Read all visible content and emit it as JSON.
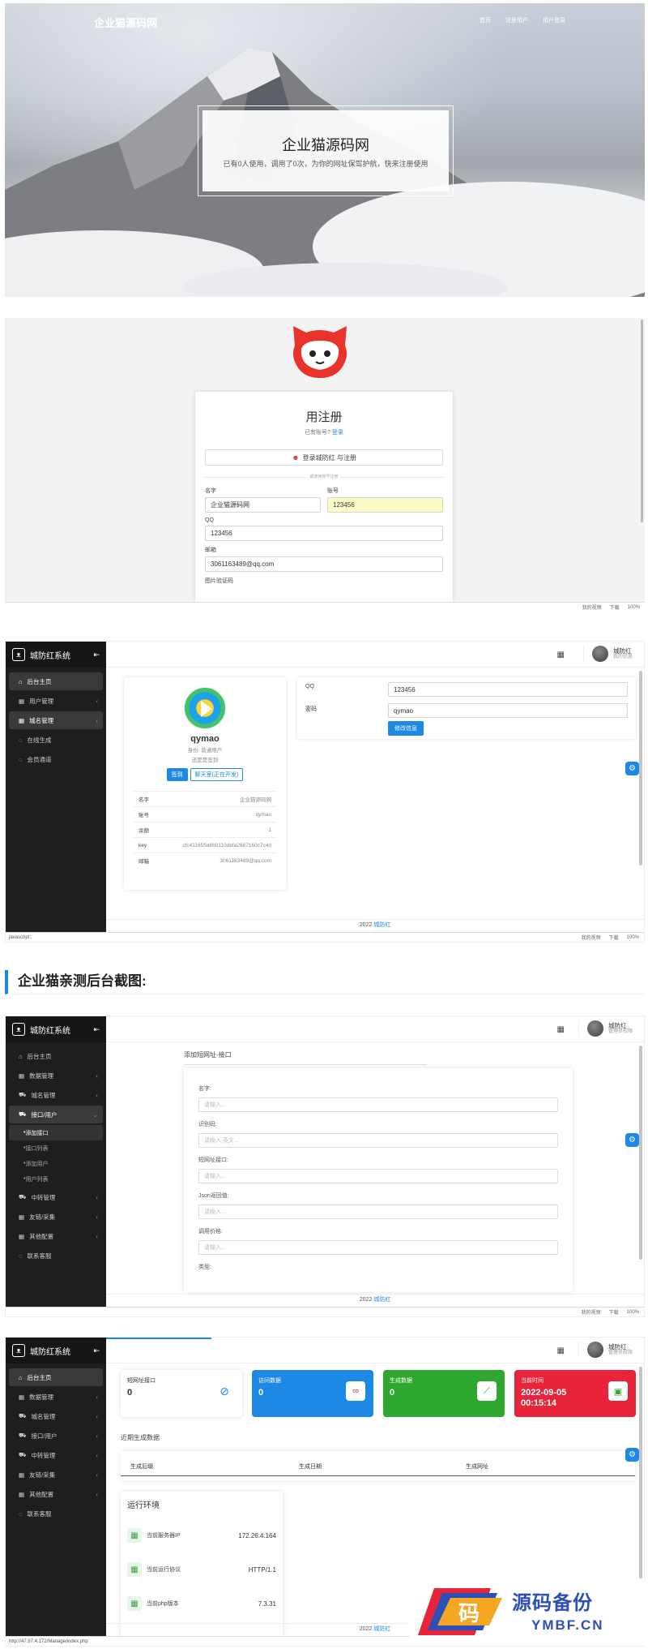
{
  "hero": {
    "site_name": "企业猫源码网",
    "nav": [
      "首页",
      "注册用户",
      "用户登录"
    ],
    "title": "企业猫源码网",
    "subtitle": "已有0人使用，调用了0次，为你的网址保驾护航，快来注册使用"
  },
  "register": {
    "title": "用注册",
    "have_account": "已有账号?",
    "login_link": "登录",
    "qq_button": "登录城防红 与注册",
    "divider": "或使用账号注册",
    "name_label": "名字",
    "name_value": "企业猫源码网",
    "account_label": "账号",
    "account_value": "123456",
    "qq_label": "QQ",
    "qq_value": "123456",
    "email_label": "邮箱",
    "email_value": "3061163489@qq.com",
    "captcha_label": "图片验证码",
    "statusbar": [
      "我的视频",
      "下载",
      "100%"
    ]
  },
  "admin1": {
    "brand": "城防红系统",
    "menu": [
      {
        "label": "后台主页",
        "active": true
      },
      {
        "label": "用户管理",
        "arrow": true
      },
      {
        "label": "城名管理",
        "arrow": true,
        "active": true
      },
      {
        "label": "在线生成"
      },
      {
        "label": "会员通道"
      }
    ],
    "user_name": "城防红",
    "user_role": "我的信息",
    "profile": {
      "name": "qymao",
      "identity": "身份: 普通用户",
      "sign_status": "还是是签到",
      "sign_btn": "签到",
      "chat_btn": "聊天室(正在开发)",
      "rows": [
        {
          "k": "名字",
          "v": "企业猫源码网"
        },
        {
          "k": "账号",
          "v": "qymao"
        },
        {
          "k": "余额",
          "v": "1"
        },
        {
          "k": "key",
          "v": "cfc411655a6b0110defa2687160c7c4d"
        },
        {
          "k": "邮箱",
          "v": "3061163489@qq.com"
        }
      ]
    },
    "qq_label": "QQ",
    "qq_value": "123456",
    "pwd_label": "密码",
    "pwd_value": "qymao",
    "save_btn": "修改信息",
    "footer_year": "2022",
    "footer_link": "城防红",
    "status_left": "javascript:;",
    "statusbar": [
      "我的视频",
      "下载",
      "100%"
    ]
  },
  "heading": "企业猫亲测后台截图:",
  "admin2": {
    "brand": "城防红系统",
    "menu": [
      {
        "label": "后台主页"
      },
      {
        "label": "数据管理",
        "arrow": true
      },
      {
        "label": "城名管理",
        "arrow": true
      },
      {
        "label": "接口/用户",
        "arrow": true,
        "active": true
      }
    ],
    "submenu": [
      {
        "label": "添加接口",
        "active": true
      },
      {
        "label": "接口列表"
      },
      {
        "label": "添加用户"
      },
      {
        "label": "用户列表"
      }
    ],
    "menu2": [
      {
        "label": "中转管理",
        "arrow": true
      },
      {
        "label": "友链/采集",
        "arrow": true
      },
      {
        "label": "其他配置",
        "arrow": true
      },
      {
        "label": "联系客服"
      }
    ],
    "user_name": "城防红",
    "user_role": "管理员权限",
    "form_title": "添加短网址-接口",
    "fields": [
      {
        "label": "名字:",
        "placeholder": "请输入..."
      },
      {
        "label": "识别码:",
        "placeholder": "请输入,英文..."
      },
      {
        "label": "短网址接口:",
        "placeholder": "请输入..."
      },
      {
        "label": "Json返回值:",
        "placeholder": "请输入..."
      },
      {
        "label": "调用价格:",
        "placeholder": "请输入..."
      },
      {
        "label": "类型:",
        "placeholder": ""
      }
    ],
    "footer_year": "2022",
    "footer_link": "城防红",
    "statusbar": [
      "我的视频",
      "下载",
      "100%"
    ]
  },
  "admin3": {
    "brand": "城防红系统",
    "menu": [
      {
        "label": "后台主页",
        "active": true
      },
      {
        "label": "数据管理",
        "arrow": true
      },
      {
        "label": "城名管理",
        "arrow": true
      },
      {
        "label": "接口/用户",
        "arrow": true
      },
      {
        "label": "中转管理",
        "arrow": true
      },
      {
        "label": "友链/采集",
        "arrow": true
      },
      {
        "label": "其他配置",
        "arrow": true
      },
      {
        "label": "联系客服"
      }
    ],
    "user_name": "城防红",
    "user_role": "管理员权限",
    "stats": [
      {
        "label": "短网址接口",
        "value": "0",
        "bg": "#ffffff",
        "fg": "#333333"
      },
      {
        "label": "访问数据",
        "value": "0",
        "bg": "#1e88e5",
        "fg": "#ffffff"
      },
      {
        "label": "生成数据",
        "value": "0",
        "bg": "#2ea82e",
        "fg": "#ffffff"
      },
      {
        "label": "当前时间",
        "value": "2022-09-05 00:15:14",
        "bg": "#e8243a",
        "fg": "#ffffff"
      }
    ],
    "recent_title": "近期生成数据",
    "table_headers": [
      "生成后缀",
      "生成日期",
      "生成网址"
    ],
    "env_title": "运行环境",
    "env": [
      {
        "k": "当前服务器IP",
        "v": "172.26.4.164"
      },
      {
        "k": "当前运行协议",
        "v": "HTTP/1.1"
      },
      {
        "k": "当前php版本",
        "v": "7.3.31"
      }
    ],
    "footer_year": "2022",
    "footer_link": "城防红",
    "status_left": "http://47.97.4.172/Manage/index.php"
  },
  "watermark": {
    "cn": "源码备份",
    "en": "YMBF.CN",
    "glyph": "码"
  }
}
